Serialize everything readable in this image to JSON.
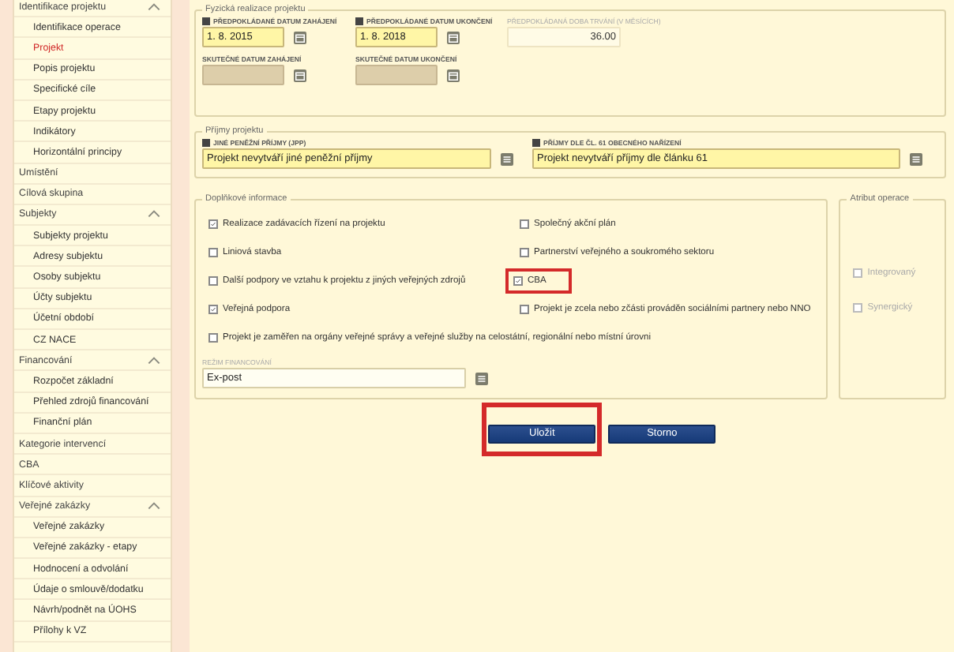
{
  "sidebar": {
    "items": [
      {
        "label": "Identifikace projektu",
        "selected": false,
        "expanded": true,
        "children": [
          {
            "label": "Identifikace operace",
            "selected": false
          },
          {
            "label": "Projekt",
            "selected": true
          },
          {
            "label": "Popis projektu",
            "selected": false
          },
          {
            "label": "Specifické cíle",
            "selected": false
          },
          {
            "label": "Etapy projektu",
            "selected": false
          },
          {
            "label": "Indikátory",
            "selected": false
          },
          {
            "label": "Horizontální principy",
            "selected": false
          }
        ]
      },
      {
        "label": "Umístění",
        "selected": false
      },
      {
        "label": "Cílová skupina",
        "selected": false
      },
      {
        "label": "Subjekty",
        "selected": false,
        "expanded": true,
        "children": [
          {
            "label": "Subjekty projektu",
            "selected": false
          },
          {
            "label": "Adresy subjektu",
            "selected": false
          },
          {
            "label": "Osoby subjektu",
            "selected": false
          },
          {
            "label": "Účty subjektu",
            "selected": false
          },
          {
            "label": "Účetní období",
            "selected": false
          },
          {
            "label": "CZ NACE",
            "selected": false
          }
        ]
      },
      {
        "label": "Financování",
        "selected": false,
        "expanded": true,
        "children": [
          {
            "label": "Rozpočet základní",
            "selected": false
          },
          {
            "label": "Přehled zdrojů financování",
            "selected": false
          },
          {
            "label": "Finanční plán",
            "selected": false
          }
        ]
      },
      {
        "label": "Kategorie intervencí",
        "selected": false
      },
      {
        "label": "CBA",
        "selected": false
      },
      {
        "label": "Klíčové aktivity",
        "selected": false
      },
      {
        "label": "Veřejné zakázky",
        "selected": false,
        "expanded": true,
        "children": [
          {
            "label": "Veřejné zakázky",
            "selected": false
          },
          {
            "label": "Veřejné zakázky - etapy",
            "selected": false
          },
          {
            "label": "Hodnocení a odvolání",
            "selected": false
          },
          {
            "label": "Údaje o smlouvě/dodatku",
            "selected": false
          },
          {
            "label": "Návrh/podnět na ÚOHS",
            "selected": false
          },
          {
            "label": "Přílohy k VZ",
            "selected": false
          }
        ]
      }
    ]
  },
  "realization": {
    "legend": "Fyzická realizace projektu",
    "fields": [
      {
        "kind": "date",
        "label": "PŘEDPOKLÁDANÉ DATUM ZAHÁJENÍ",
        "value": "1. 8. 2015",
        "required": true,
        "disabled": false
      },
      {
        "kind": "date",
        "label": "PŘEDPOKLÁDANÉ DATUM UKONČENÍ",
        "value": "1. 8. 2018",
        "required": true,
        "disabled": false
      },
      {
        "kind": "number",
        "label": "PŘEDPOKLÁDANÁ DOBA TRVÁNÍ (V MĚSÍCÍCH)",
        "value": "36.00",
        "required": false,
        "disabled": true
      },
      {
        "kind": "date",
        "label": "SKUTEČNÉ DATUM ZAHÁJENÍ",
        "required": false,
        "disabled": true
      },
      {
        "kind": "date",
        "label": "SKUTEČNÉ DATUM UKONČENÍ",
        "required": false,
        "disabled": true
      }
    ]
  },
  "income": {
    "legend": "Příjmy projektu",
    "fields": [
      {
        "label": "JINÉ PENĚŽNÍ PŘÍJMY (JPP)",
        "value": "Projekt nevytváří jiné peněžní příjmy",
        "required": true
      },
      {
        "label": "PŘÍJMY DLE ČL. 61 OBECNÉHO NAŘÍZENÍ",
        "value": "Projekt nevytváří příjmy dle článku 61",
        "required": true
      }
    ]
  },
  "additional": {
    "legend": "Doplňkové informace",
    "checkboxes": [
      {
        "label": "Realizace zadávacích řízení na projektu",
        "checked": true,
        "highlighted": false
      },
      {
        "label": "Společný akční plán",
        "checked": false,
        "highlighted": false
      },
      {
        "label": "Liniová stavba",
        "checked": false,
        "highlighted": false
      },
      {
        "label": "Partnerství veřejného a soukromého sektoru",
        "checked": false,
        "highlighted": false
      },
      {
        "label": "Další podpory ve vztahu k projektu z jiných veřejných zdrojů",
        "checked": false,
        "highlighted": false
      },
      {
        "label": "CBA",
        "checked": true,
        "highlighted": true
      },
      {
        "label": "Veřejná podpora",
        "checked": true,
        "highlighted": false
      },
      {
        "label": "Projekt je zcela nebo zčásti prováděn sociálními partnery nebo NNO",
        "checked": false,
        "highlighted": false
      },
      {
        "label": "Projekt je zaměřen na orgány veřejné správy a veřejné služby na celostátní, regionální nebo místní úrovni",
        "checked": false,
        "highlighted": false
      }
    ],
    "financing": {
      "label": "REŽIM FINANCOVÁNÍ",
      "value": "Ex-post"
    }
  },
  "attribute": {
    "legend": "Atribut operace",
    "checkboxes": [
      {
        "label": "Integrovaný",
        "checked": false,
        "disabled": true
      },
      {
        "label": "Synergický",
        "checked": false,
        "disabled": true
      }
    ]
  },
  "buttons": [
    {
      "label": "Uložit",
      "highlighted": true
    },
    {
      "label": "Storno",
      "highlighted": false
    }
  ]
}
